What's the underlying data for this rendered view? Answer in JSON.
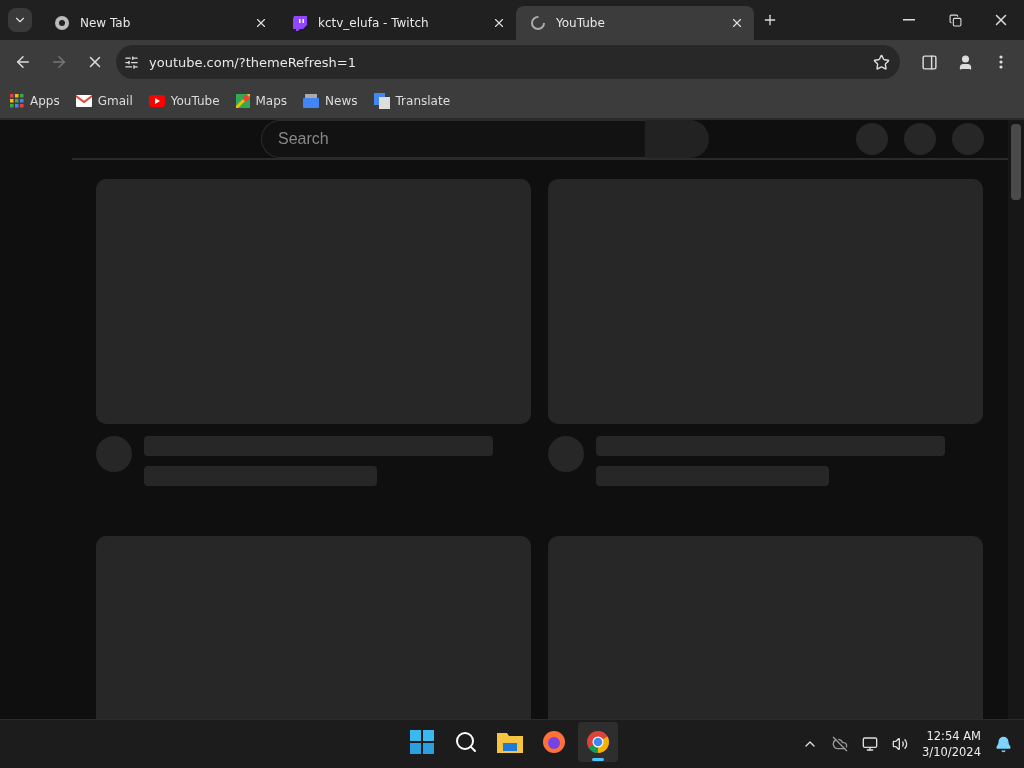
{
  "tabs": [
    {
      "kind": "chrome",
      "title": "New Tab",
      "selected": false
    },
    {
      "kind": "twitch",
      "title": "kctv_elufa - Twitch",
      "selected": false
    },
    {
      "kind": "loading",
      "title": "YouTube",
      "selected": true
    }
  ],
  "toolbar": {
    "address": "youtube.com/?themeRefresh=1",
    "loading": true
  },
  "bookmarks": [
    {
      "kind": "apps",
      "label": "Apps"
    },
    {
      "kind": "gmail",
      "label": "Gmail"
    },
    {
      "kind": "youtube",
      "label": "YouTube"
    },
    {
      "kind": "maps",
      "label": "Maps"
    },
    {
      "kind": "news",
      "label": "News"
    },
    {
      "kind": "translate",
      "label": "Translate"
    }
  ],
  "page": {
    "search": {
      "placeholder": "Search"
    }
  },
  "taskbar": {
    "apps": [
      {
        "kind": "start",
        "active": false
      },
      {
        "kind": "search",
        "active": false
      },
      {
        "kind": "files",
        "active": false
      },
      {
        "kind": "firefox",
        "active": false
      },
      {
        "kind": "chrome",
        "active": true
      }
    ],
    "time": "12:54 AM",
    "date": "3/10/2024"
  }
}
